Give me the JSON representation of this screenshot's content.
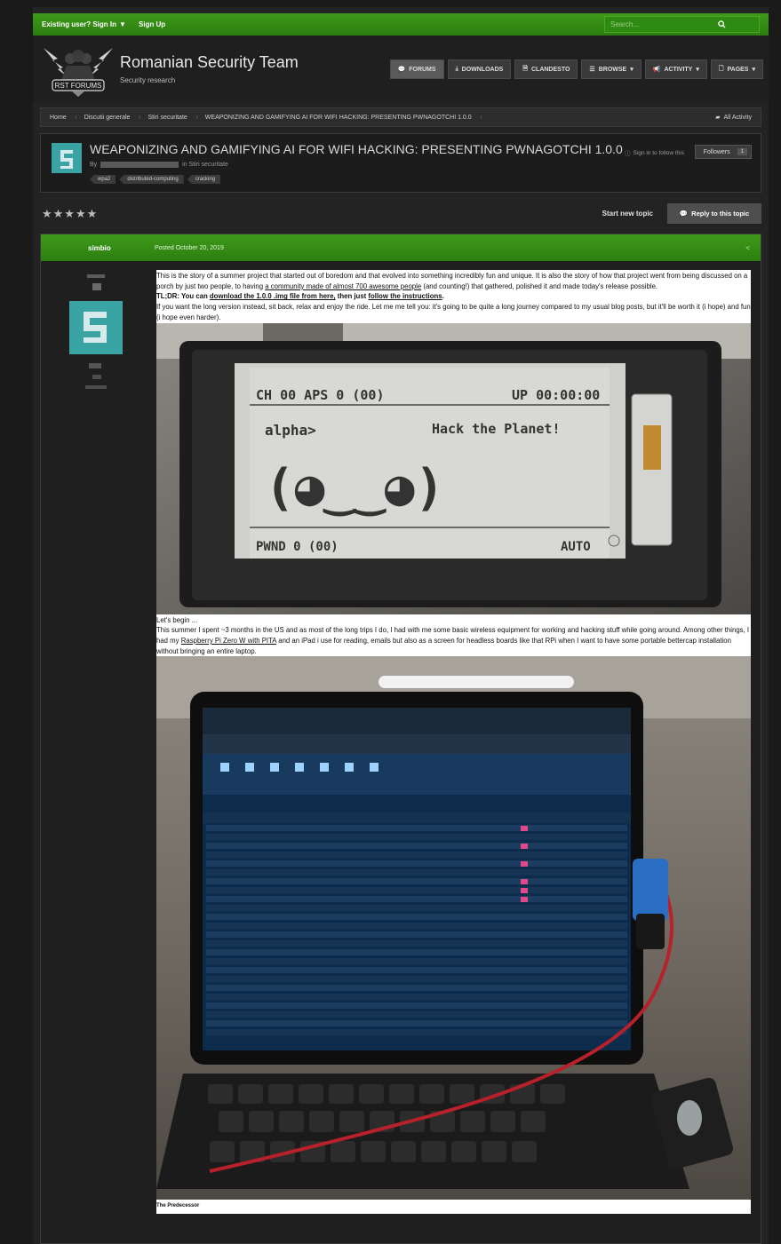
{
  "topbar": {
    "signin": "Existing user? Sign In",
    "signup": "Sign Up",
    "search_placeholder": "Search..."
  },
  "header": {
    "logo_text": "RST FORUMS",
    "site_name": "Romanian Security Team",
    "tagline": "Security research",
    "nav": [
      {
        "label": "FORUMS",
        "icon": "comments-icon"
      },
      {
        "label": "DOWNLOADS",
        "icon": "download-icon"
      },
      {
        "label": "CLANDESTO",
        "icon": "document-icon"
      },
      {
        "label": "BROWSE",
        "icon": "list-icon"
      },
      {
        "label": "ACTIVITY",
        "icon": "megaphone-icon"
      },
      {
        "label": "PAGES",
        "icon": "page-icon"
      }
    ]
  },
  "breadcrumb": {
    "items": [
      "Home",
      "Discutii generale",
      "Stiri securitate",
      "WEAPONIZING AND GAMIFYING AI FOR WIFI HACKING: PRESENTING PWNAGOTCHI 1.0.0"
    ],
    "all_activity": "All Activity"
  },
  "topic": {
    "title": "WEAPONIZING AND GAMIFYING AI FOR WIFI HACKING: PRESENTING PWNAGOTCHI 1.0.0",
    "by": "By",
    "in_forum": "in Stiri securitate",
    "tags": [
      "wpa2",
      "distributed-computing",
      "cracking"
    ],
    "follow_hint": "Sign in to follow this",
    "followers_label": "Followers",
    "followers_count": "1"
  },
  "actions": {
    "rating_stars": 5,
    "start_new_topic": "Start new topic",
    "reply": "Reply to this topic"
  },
  "post": {
    "author": "simbio",
    "date": "Posted October 20, 2019",
    "p1_a": "This is the story of a summer project that started out of boredom and that evolved into something incredibly fun and unique. It is also the story of how that project went from being discussed on a porch by just two people, to having ",
    "p1_link": "a community made of almost 700 awesome people",
    "p1_b": " (and counting!) that gathered, polished it and made today's release possible.",
    "tldr_a": "TL;DR: You can ",
    "tldr_link1": "download the 1.0.0 .img file from here,",
    "tldr_b": " then just ",
    "tldr_link2": "follow the instructions",
    "tldr_c": ".",
    "p2": "If you want the long version instead, sit back, relax and enjoy the ride. Let me me tell you: it's going to be quite a long journey compared to my usual blog posts, but it'll be worth it (i hope) and fun (i hope even harder).",
    "eink": {
      "ch": "CH 00 APS 0 (00)",
      "up": "UP 00:00:00",
      "name": "alpha>",
      "status": "Hack the Planet!",
      "face": "(◕‿‿◕)",
      "pwnd": "PWND 0 (00)",
      "mode": "AUTO"
    },
    "p3": "Let's begin ...",
    "p4_a": "This summer I spent ~3 months in the US and as most of the long trips I do, I had with me some basic wireless equipment for working and hacking stuff while going around. Among other things, I had my ",
    "p4_link": "Raspberry Pi Zero W with PITA",
    "p4_b": " and an iPad i use for reading, emails but also as a screen for headless boards like that RPi when I want to have some portable bettercap installation without bringing an entire laptop.",
    "predecessor": "The Predecessor"
  }
}
